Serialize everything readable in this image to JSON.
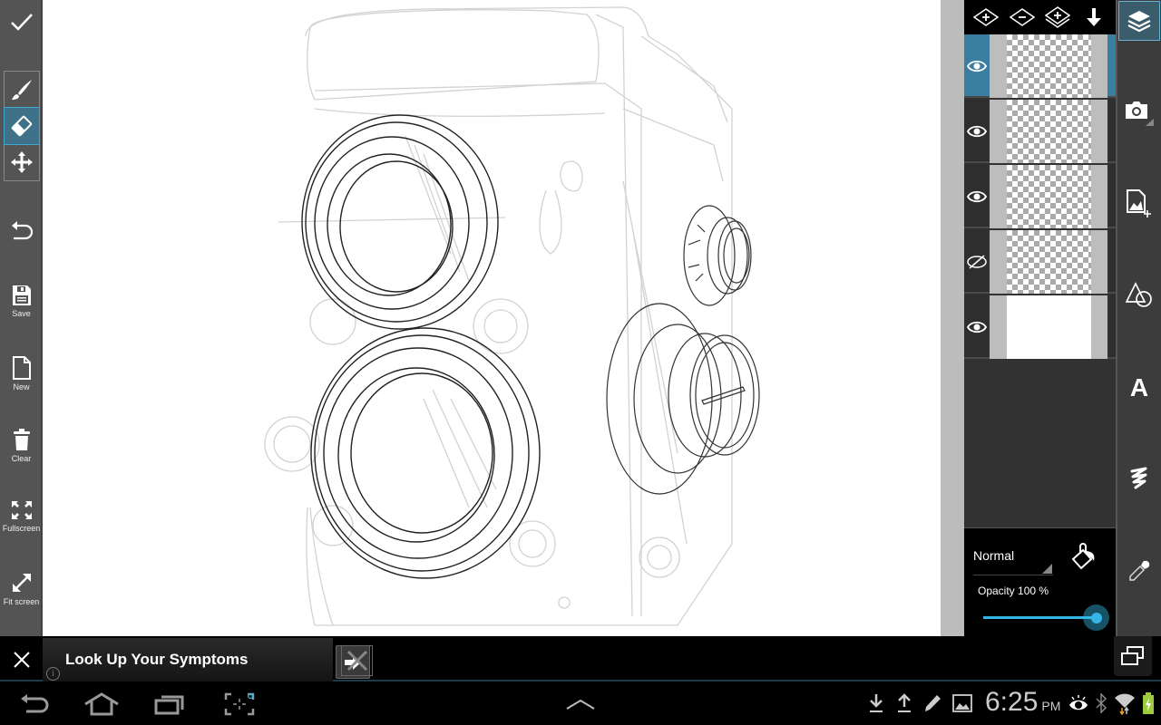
{
  "left_toolbar": {
    "done": {
      "icon": "check-icon"
    },
    "tools": [
      {
        "name": "brush",
        "icon": "brush-icon",
        "active": false
      },
      {
        "name": "eraser",
        "icon": "eraser-icon",
        "active": true
      },
      {
        "name": "move",
        "icon": "move-icon",
        "active": false
      }
    ],
    "undo": {
      "icon": "undo-icon"
    },
    "actions": [
      {
        "label": "Save",
        "icon": "save-icon"
      },
      {
        "label": "New",
        "icon": "new-file-icon"
      },
      {
        "label": "Clear",
        "icon": "trash-icon"
      },
      {
        "label": "Fullscreen",
        "icon": "fullscreen-icon"
      },
      {
        "label": "Fit screen",
        "icon": "fit-screen-icon"
      }
    ]
  },
  "layer_toolbar": [
    {
      "name": "add-layer",
      "icon": "add-layer-icon"
    },
    {
      "name": "remove-layer",
      "icon": "remove-layer-icon"
    },
    {
      "name": "duplicate-layer",
      "icon": "duplicate-layer-icon"
    },
    {
      "name": "merge-down",
      "icon": "arrow-down-icon"
    }
  ],
  "layers": [
    {
      "visible": true,
      "selected": true,
      "thumb": "transparent"
    },
    {
      "visible": true,
      "selected": false,
      "thumb": "transparent"
    },
    {
      "visible": true,
      "selected": false,
      "thumb": "transparent"
    },
    {
      "visible": false,
      "selected": false,
      "thumb": "transparent"
    },
    {
      "visible": true,
      "selected": false,
      "thumb": "white"
    }
  ],
  "layer_props": {
    "blend_mode": "Normal",
    "opacity_label": "Opacity  100 %",
    "opacity_value": 100
  },
  "right_rail": [
    {
      "name": "layers",
      "icon": "layers-icon",
      "active": true
    },
    {
      "name": "camera",
      "icon": "camera-icon",
      "active": false
    },
    {
      "name": "import-image",
      "icon": "add-image-icon",
      "active": false
    },
    {
      "name": "shapes",
      "icon": "shapes-icon",
      "active": false
    },
    {
      "name": "text",
      "icon": "text-icon",
      "active": false,
      "glyph": "A"
    },
    {
      "name": "smudge",
      "icon": "squiggle-icon",
      "active": false
    },
    {
      "name": "eyedropper",
      "icon": "eyedropper-icon",
      "active": false
    }
  ],
  "ad": {
    "title": "Look Up Your Symptoms",
    "info": "i"
  },
  "system_bar": {
    "time": "6:25",
    "ampm": "PM",
    "nav": [
      "back",
      "home",
      "recent-apps",
      "screenshot"
    ],
    "status_icons": [
      "download",
      "upload",
      "edit",
      "gallery",
      "smart-stay",
      "bluetooth",
      "wifi",
      "battery-charging"
    ]
  }
}
